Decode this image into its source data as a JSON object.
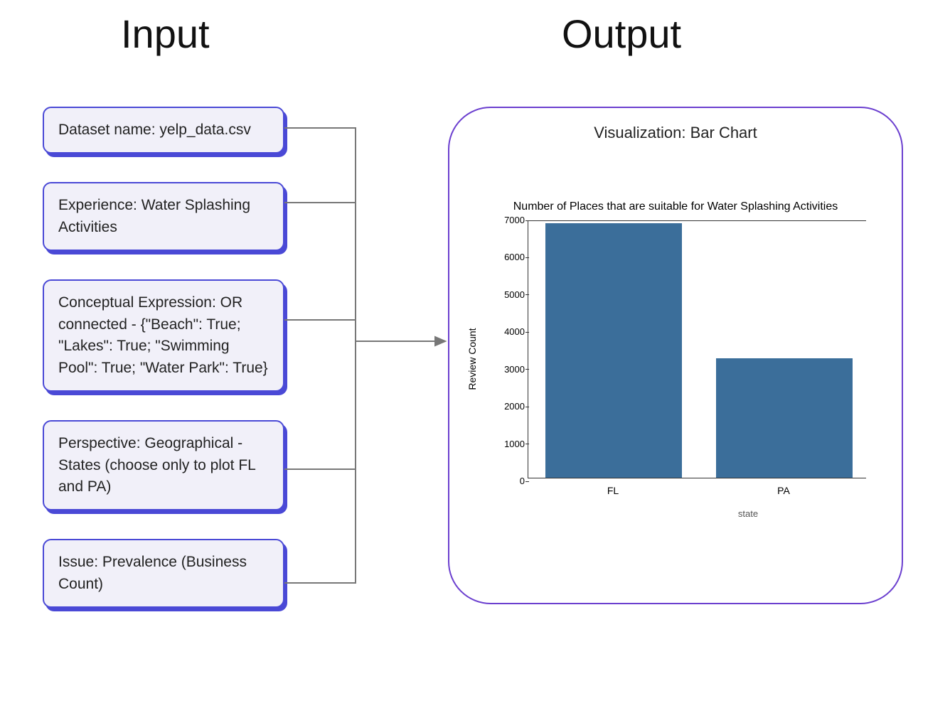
{
  "headings": {
    "input": "Input",
    "output": "Output"
  },
  "input_boxes": [
    {
      "text": "Dataset name: yelp_data.csv"
    },
    {
      "text": "Experience: Water Splashing Activities"
    },
    {
      "text": "Conceptual Expression: OR connected - {\"Beach\": True; \"Lakes\": True; \"Swimming Pool\": True; \"Water Park\": True}"
    },
    {
      "text": "Perspective: Geographical - States (choose only to plot FL and PA)"
    },
    {
      "text": "Issue: Prevalence (Business Count)"
    }
  ],
  "output": {
    "viz_label": "Visualization: Bar Chart"
  },
  "chart_data": {
    "type": "bar",
    "title": "Number of Places that are suitable for Water Splashing Activities",
    "categories": [
      "FL",
      "PA"
    ],
    "values": [
      6950,
      3250
    ],
    "ylabel": "Review Count",
    "xlabel": "state",
    "ylim": [
      0,
      7000
    ],
    "yticks": [
      0,
      1000,
      2000,
      3000,
      4000,
      5000,
      6000,
      7000
    ]
  }
}
